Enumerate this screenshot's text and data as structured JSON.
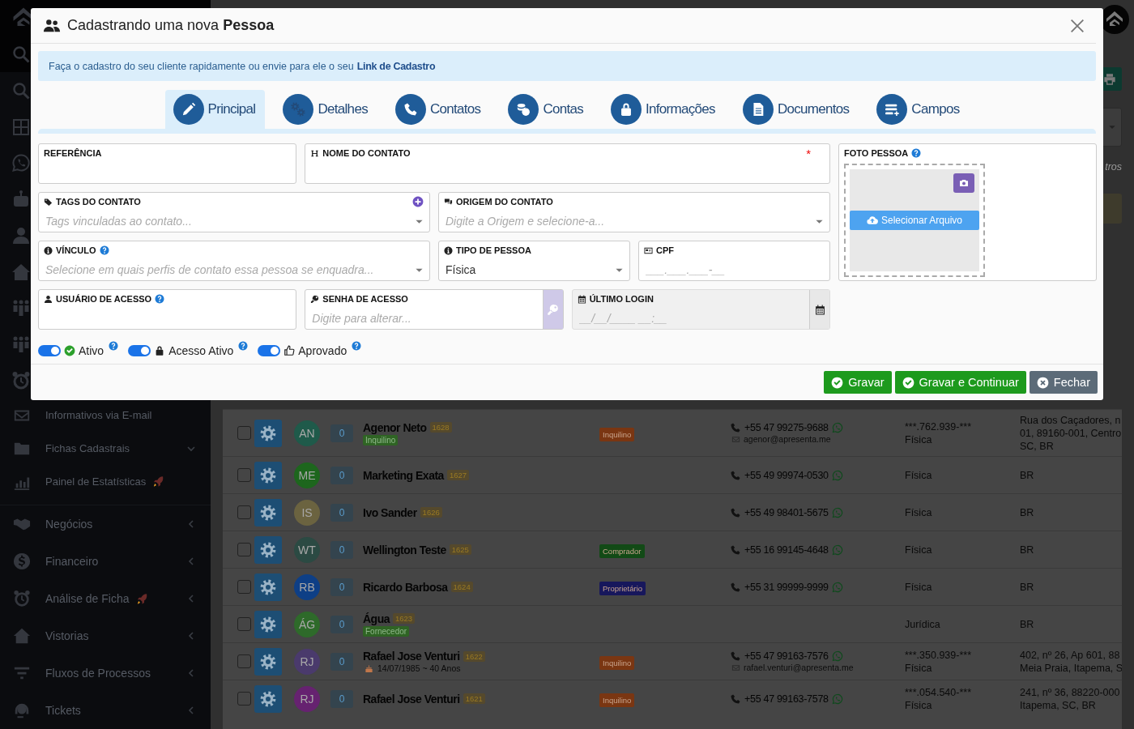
{
  "sidebar": {
    "groups": [
      {
        "items": [
          {
            "label": "Informativos via E-mail",
            "submenu": false,
            "rocket": false
          },
          {
            "label": "Fichas Cadastrais",
            "submenu": true,
            "expanded": true,
            "rocket": false
          },
          {
            "label": "Painel de Estatísticas",
            "submenu": false,
            "rocket": true
          }
        ]
      },
      {
        "items": [
          {
            "label": "Negócios",
            "submenu": true,
            "expanded": false,
            "rocket": false
          },
          {
            "label": "Financeiro",
            "submenu": true,
            "expanded": false,
            "rocket": false
          },
          {
            "label": "Análise de Ficha",
            "submenu": true,
            "expanded": false,
            "rocket": true
          },
          {
            "label": "Vistorias",
            "submenu": true,
            "expanded": false,
            "rocket": false
          },
          {
            "label": "Fluxos de Processos",
            "submenu": true,
            "expanded": false,
            "rocket": false
          },
          {
            "label": "Tickets",
            "submenu": true,
            "expanded": false,
            "rocket": false
          }
        ]
      }
    ]
  },
  "toolbar": {
    "filter_hint": "tros"
  },
  "table": {
    "rows": [
      {
        "selected": false,
        "avatar": {
          "initials": "AN",
          "color": "#1f5a4a"
        },
        "count": "0",
        "name": "Agenor Neto",
        "code": "1628",
        "subtag": {
          "label": "Inquilino",
          "color": "#2f6424"
        },
        "tag": {
          "label": "Inquilino",
          "color": "#7a3612"
        },
        "phone": "+55 47 99275-9688",
        "email": "agenor@apresenta.me",
        "document": "***.762.939-***",
        "person_type": "Física",
        "address": [
          "Rua dos Caçadores, n",
          "01, 89160-001, Centro",
          "SC, BR"
        ]
      },
      {
        "selected": false,
        "avatar": {
          "initials": "ME",
          "color": "#1d661d"
        },
        "count": "0",
        "name": "Marketing Exata",
        "code": "1627",
        "phone": "+55 49 99974-0530",
        "person_type": "Física",
        "address": [
          "BR"
        ]
      },
      {
        "selected": false,
        "avatar": {
          "initials": "IS",
          "color": "#6b6340"
        },
        "count": "0",
        "name": "Ivo Sander",
        "code": "1626",
        "phone": "+55 49 98401-5675",
        "person_type": "Física",
        "address": [
          "BR"
        ]
      },
      {
        "selected": false,
        "avatar": {
          "initials": "WT",
          "color": "#2b4a43"
        },
        "count": "0",
        "name": "Wellington Teste",
        "code": "1625",
        "tag": {
          "label": "Comprador",
          "color": "#124a16"
        },
        "phone": "+55 16 99145-4648",
        "person_type": "Física",
        "address": [
          "BR"
        ]
      },
      {
        "selected": false,
        "avatar": {
          "initials": "RB",
          "color": "#0e3f86"
        },
        "count": "0",
        "name": "Ricardo Barbosa",
        "code": "1624",
        "tag": {
          "label": "Proprietário",
          "color": "#17175c"
        },
        "phone": "+55 31 99999-9999",
        "person_type": "Física",
        "address": [
          "BR"
        ]
      },
      {
        "selected": false,
        "avatar": {
          "initials": "ÁG",
          "color": "#2e6a2a"
        },
        "count": "0",
        "name": "Água",
        "code": "1623",
        "subtag": {
          "label": "Fornecedor",
          "color": "#2f6424"
        },
        "person_type": "Jurídica",
        "address": [
          "BR"
        ]
      },
      {
        "selected": false,
        "avatar": {
          "initials": "RJ",
          "color": "#4a3a6c"
        },
        "count": "0",
        "name": "Rafael Jose Venturi",
        "code": "1622",
        "birthday": "14/07/1985 ~ 40 Anos",
        "tag": {
          "label": "Inquilino",
          "color": "#7a3612"
        },
        "phone": "+55 47 99163-7576",
        "email": "rafael.venturi@apresenta.me",
        "document": "***.350.939-***",
        "person_type": "Física",
        "address": [
          "402, nº 26, Ap 601, 88",
          "Meia Praia, Itapema, S"
        ]
      },
      {
        "selected": false,
        "avatar": {
          "initials": "RJ",
          "color": "#662270"
        },
        "count": "0",
        "name": "Rafael Jose Venturi",
        "code": "1621",
        "tag": {
          "label": "Inquilino",
          "color": "#7a3612"
        },
        "phone": "+55 47 99163-7578",
        "document": "***.054.540-***",
        "person_type": "Física",
        "address": [
          "241, nº 36, 88220-000",
          "Itapema, SC, BR"
        ]
      }
    ]
  },
  "modal": {
    "title": "Cadastrando uma nova **Pessoa**",
    "alert": {
      "text": "Faça o cadastro do seu cliente rapidamente ou envie para ele o seu",
      "link": "Link de Cadastro"
    },
    "tabs": [
      {
        "label": "Principal",
        "selected": true
      },
      {
        "label": "Detalhes",
        "selected": false
      },
      {
        "label": "Contatos",
        "selected": false
      },
      {
        "label": "Contas",
        "selected": false
      },
      {
        "label": "Informações",
        "selected": false
      },
      {
        "label": "Documentos",
        "selected": false
      },
      {
        "label": "Campos",
        "selected": false
      }
    ],
    "fields": [
      {
        "label": "REFERÊNCIA",
        "kind": "text",
        "help": false,
        "add_button": false,
        "disabled": false
      },
      {
        "label": "NOME DO CONTATO",
        "kind": "text",
        "required_mark": "*",
        "help": false,
        "add_button": false,
        "disabled": false
      },
      {
        "label": "TAGS DO CONTATO",
        "kind": "select",
        "placeholder": "Tags vinculadas ao contato...",
        "help": false,
        "add_button": true,
        "disabled": false
      },
      {
        "label": "ORIGEM DO CONTATO",
        "kind": "select",
        "placeholder": "Digite a Origem e selecione-a...",
        "help": false,
        "add_button": false,
        "disabled": false
      },
      {
        "label": "VÍNCULO",
        "kind": "select",
        "placeholder": "Selecione em quais perfis de contato essa pessoa se enquadra...",
        "help": true,
        "add_button": false,
        "disabled": false
      },
      {
        "label": "TIPO DE PESSOA",
        "kind": "select",
        "value": "Física",
        "help": false,
        "add_button": false,
        "disabled": false
      },
      {
        "label": "CPF",
        "kind": "text",
        "placeholder": "___.___.___-__",
        "help": false,
        "add_button": false,
        "disabled": false
      },
      {
        "label": "USUÁRIO DE ACESSO",
        "kind": "text",
        "help": true,
        "add_button": false,
        "disabled": false
      },
      {
        "label": "SENHA DE ACESSO",
        "kind": "password",
        "placeholder": "Digite para alterar...",
        "help": false,
        "add_button": false,
        "disabled": false
      },
      {
        "label": "ÚLTIMO LOGIN",
        "kind": "date",
        "placeholder": "__/__/____ __:__",
        "help": false,
        "add_button": false,
        "disabled": true
      }
    ],
    "photo": {
      "label": "FOTO PESSOA",
      "help": true,
      "button": "Selecionar Arquivo"
    },
    "toggles": [
      {
        "label": "Ativo",
        "on": true,
        "help": true
      },
      {
        "label": "Acesso Ativo",
        "on": true,
        "help": true
      },
      {
        "label": "Aprovado",
        "on": true,
        "help": true
      }
    ],
    "buttons": [
      {
        "label": "Gravar",
        "kind": "primary"
      },
      {
        "label": "Gravar e Continuar",
        "kind": "primary"
      },
      {
        "label": "Fechar",
        "kind": "secondary"
      }
    ]
  }
}
